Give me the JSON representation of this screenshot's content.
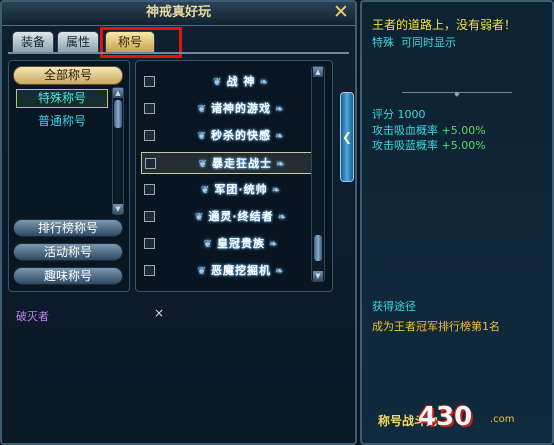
{
  "window": {
    "title": "神戒真好玩"
  },
  "tabs": [
    {
      "label": "装备"
    },
    {
      "label": "属性"
    },
    {
      "label": "称号"
    }
  ],
  "categories": {
    "top_label": "全部称号",
    "sub_items": [
      {
        "label": "特殊称号"
      },
      {
        "label": "普通称号"
      }
    ],
    "buttons": [
      {
        "label": "排行榜称号"
      },
      {
        "label": "活动称号"
      },
      {
        "label": "趣味称号"
      }
    ]
  },
  "title_list": [
    {
      "label": "战  神"
    },
    {
      "label": "诸神的游戏"
    },
    {
      "label": "秒杀的快感"
    },
    {
      "label": "暴走狂战士"
    },
    {
      "label": "军团·统帅"
    },
    {
      "label": "通灵·终结者"
    },
    {
      "label": "皇冠贵族"
    },
    {
      "label": "恶魔挖掘机"
    }
  ],
  "current_title": {
    "name": "破灭者",
    "clear_symbol": "×"
  },
  "info": {
    "name": "王者的道路上，没有弱者！",
    "type_label": "特殊",
    "type_note": "可同时显示",
    "score_label": "评分",
    "score_value": "1000",
    "stats": [
      {
        "label": "攻击吸血概率",
        "value": "+5.00%"
      },
      {
        "label": "攻击吸蓝概率",
        "value": "+5.00%"
      }
    ],
    "source_label": "获得途径",
    "source_text": "成为王者冠军排行榜第1名",
    "footer": "称号战斗力"
  },
  "watermark": {
    "text": "430",
    "suffix": ".com"
  },
  "colors": {
    "accent_yellow": "#f4e040",
    "cyan_text": "#38d8e0",
    "highlight_red": "#e31212",
    "stat_green": "#5ad86a",
    "current_purple": "#c080f0"
  }
}
